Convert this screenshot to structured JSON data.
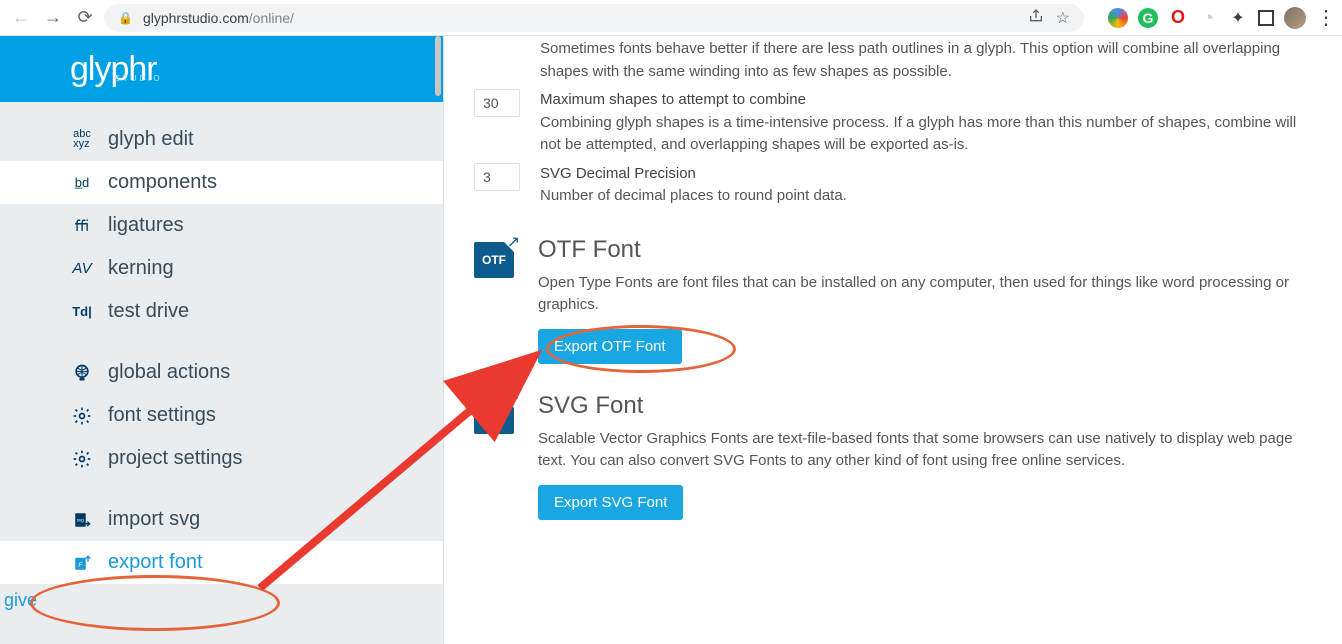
{
  "url": {
    "host": "glyphrstudio.com",
    "path": "/online/"
  },
  "logo": {
    "text": "glyphr",
    "sub": "STUDIO"
  },
  "sidebar": {
    "items": [
      {
        "icon": "abc",
        "label": "glyph edit"
      },
      {
        "icon": "bd",
        "label": "components"
      },
      {
        "icon": "ffi",
        "label": "ligatures"
      },
      {
        "icon": "AV",
        "label": "kerning"
      },
      {
        "icon": "Td",
        "label": "test drive"
      },
      {
        "icon": "globe",
        "label": "global actions"
      },
      {
        "icon": "gear",
        "label": "font settings"
      },
      {
        "icon": "gear",
        "label": "project settings"
      },
      {
        "icon": "svg",
        "label": "import svg"
      },
      {
        "icon": "F",
        "label": "export font"
      }
    ],
    "footer": "give"
  },
  "content": {
    "combine_partial": "Sometimes fonts behave better if there are less path outlines in a glyph. This option will combine all overlapping shapes with the same winding into as few shapes as possible.",
    "maxshapes": {
      "value": "30",
      "title": "Maximum shapes to attempt to combine",
      "desc": "Combining glyph shapes is a time-intensive process. If a glyph has more than this number of shapes, combine will not be attempted, and overlapping shapes will be exported as-is."
    },
    "precision": {
      "value": "3",
      "title": "SVG Decimal Precision",
      "desc": "Number of decimal places to round point data."
    },
    "otf": {
      "heading": "OTF Font",
      "desc": "Open Type Fonts are font files that can be installed on any computer, then used for things like word processing or graphics.",
      "button": "Export OTF Font"
    },
    "svg": {
      "heading": "SVG Font",
      "desc": "Scalable Vector Graphics Fonts are text-file-based fonts that some browsers can use natively to display web page text. You can also convert SVG Fonts to any other kind of font using free online services.",
      "button": "Export SVG Font"
    }
  }
}
